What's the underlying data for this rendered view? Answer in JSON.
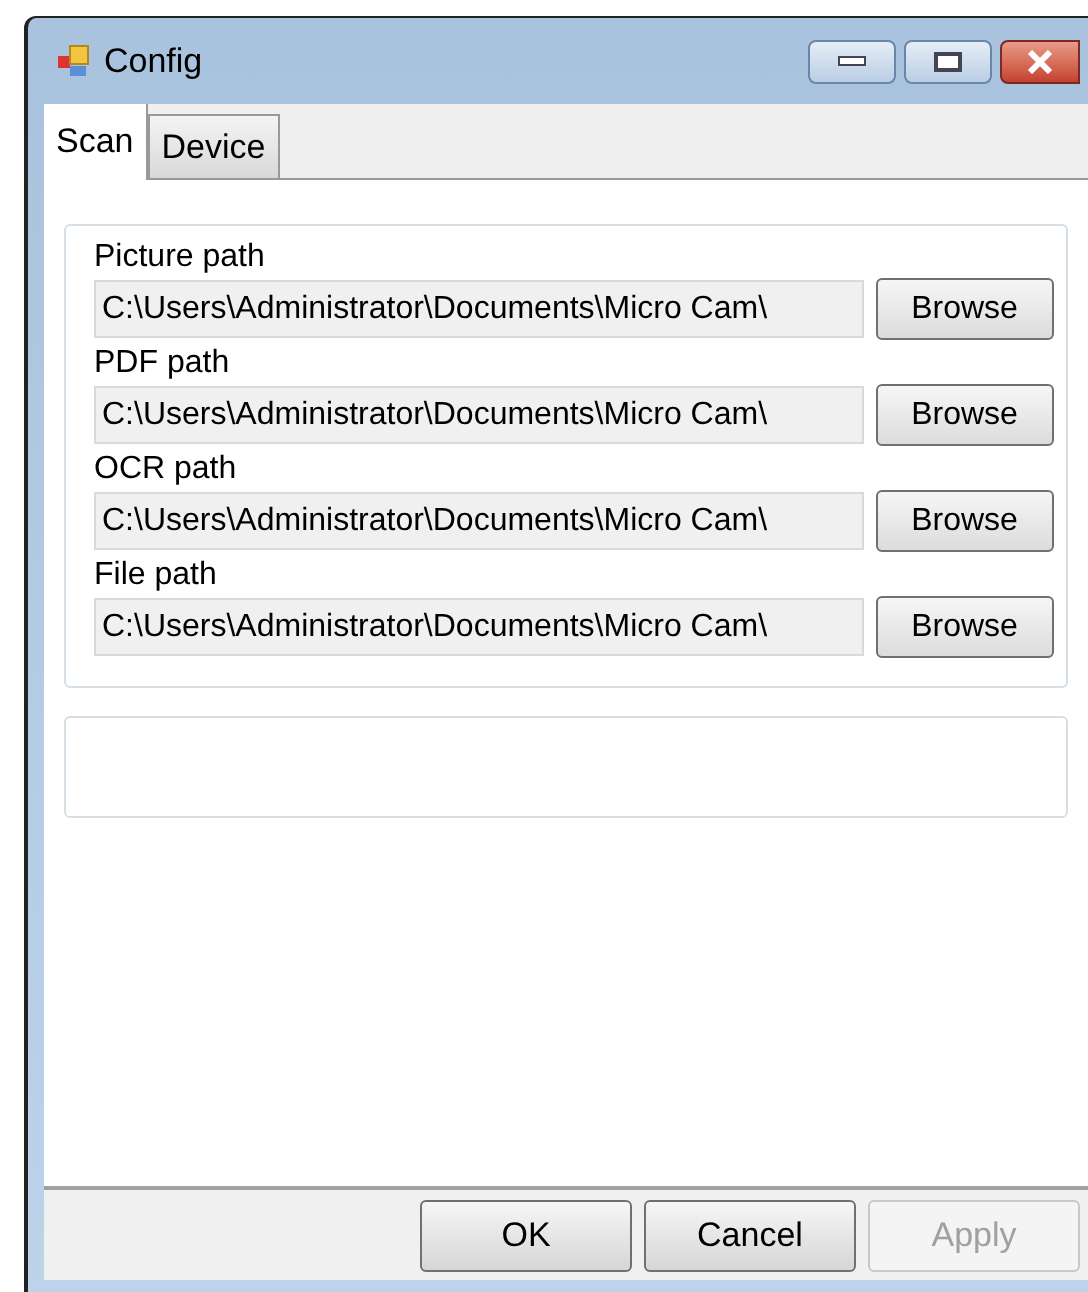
{
  "window": {
    "title": "Config"
  },
  "tabs": [
    {
      "label": "Scan",
      "selected": true
    },
    {
      "label": "Device",
      "selected": false
    }
  ],
  "paths": [
    {
      "label": "Picture path",
      "value": "C:\\Users\\Administrator\\Documents\\Micro Cam\\",
      "button": "Browse"
    },
    {
      "label": "PDF path",
      "value": "C:\\Users\\Administrator\\Documents\\Micro Cam\\",
      "button": "Browse"
    },
    {
      "label": "OCR path",
      "value": "C:\\Users\\Administrator\\Documents\\Micro Cam\\",
      "button": "Browse"
    },
    {
      "label": "File path",
      "value": "C:\\Users\\Administrator\\Documents\\Micro Cam\\",
      "button": "Browse"
    }
  ],
  "buttons": [
    {
      "label": "OK",
      "disabled": false
    },
    {
      "label": "Cancel",
      "disabled": false
    },
    {
      "label": "Apply",
      "disabled": true
    }
  ]
}
